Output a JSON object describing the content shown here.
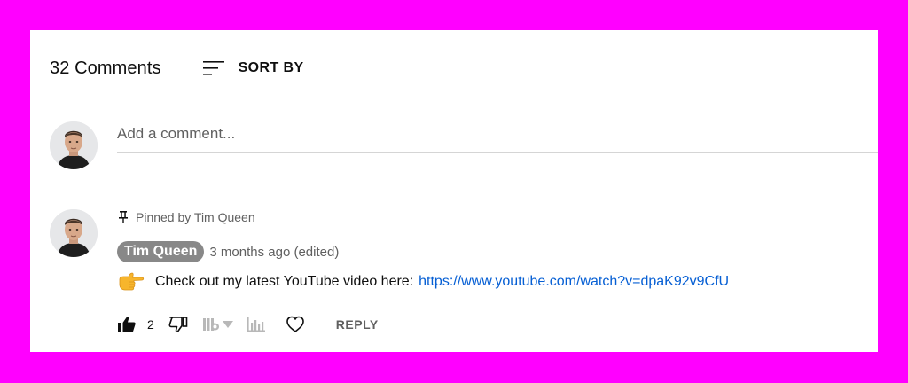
{
  "header": {
    "comment_count": "32 Comments",
    "sort_label": "SORT BY",
    "sort_icon": "sort-lines-icon"
  },
  "add_comment": {
    "placeholder": "Add a comment..."
  },
  "pinned_comment": {
    "pinned_text": "Pinned by Tim Queen",
    "author": "Tim Queen",
    "timestamp": "3 months ago (edited)",
    "text_before_link": "Check out my latest YouTube video here:",
    "link_text": "https://www.youtube.com/watch?v=dpaK92v9CfU",
    "emoji": "pointing-right-emoji",
    "like_count": "2",
    "reply_label": "REPLY"
  },
  "colors": {
    "background_frame": "#ff00ff",
    "card": "#ffffff",
    "link": "#065fd4",
    "author_badge": "#888888",
    "secondary_text": "#606060"
  }
}
